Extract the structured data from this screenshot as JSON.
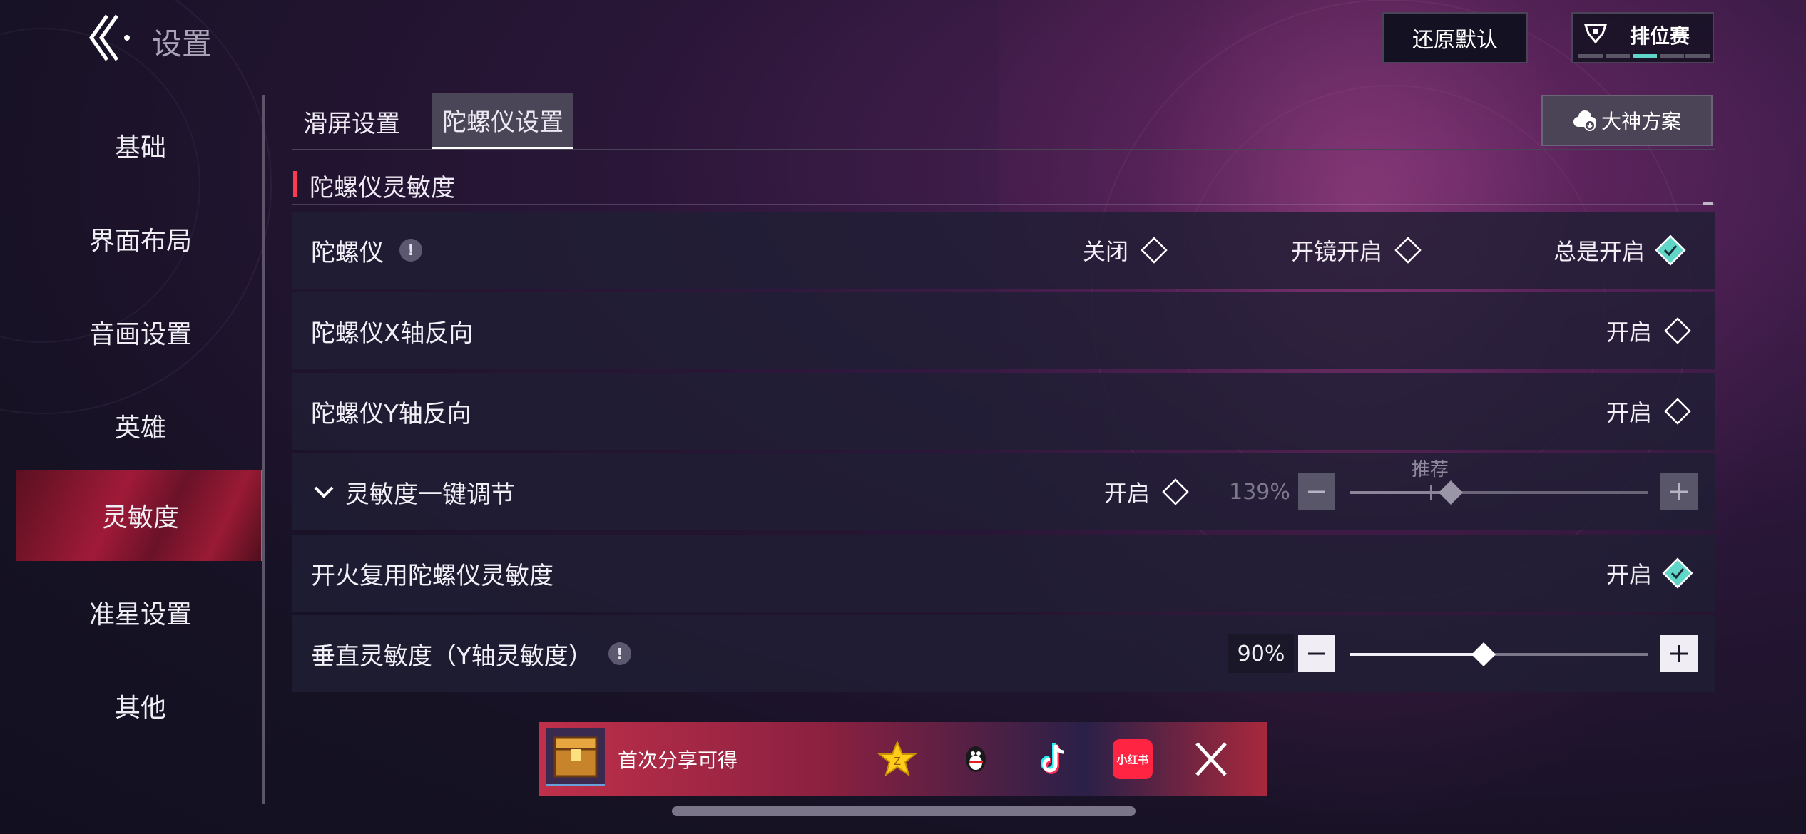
{
  "header": {
    "title": "设置",
    "reset_label": "还原默认",
    "rank_label": "排位赛"
  },
  "sidebar": {
    "items": [
      {
        "label": "基础",
        "active": false
      },
      {
        "label": "界面布局",
        "active": false
      },
      {
        "label": "音画设置",
        "active": false
      },
      {
        "label": "英雄",
        "active": false
      },
      {
        "label": "灵敏度",
        "active": true
      },
      {
        "label": "准星设置",
        "active": false
      },
      {
        "label": "其他",
        "active": false
      }
    ]
  },
  "tabs": [
    {
      "label": "滑屏设置",
      "active": false
    },
    {
      "label": "陀螺仪设置",
      "active": true
    }
  ],
  "pro_button_label": "大神方案",
  "section": {
    "title": "陀螺仪灵敏度"
  },
  "rows": {
    "gyro": {
      "label": "陀螺仪",
      "options": [
        {
          "label": "关闭",
          "selected": false
        },
        {
          "label": "开镜开启",
          "selected": false
        },
        {
          "label": "总是开启",
          "selected": true
        }
      ]
    },
    "x_invert": {
      "label": "陀螺仪X轴反向",
      "option": "开启",
      "selected": false
    },
    "y_invert": {
      "label": "陀螺仪Y轴反向",
      "option": "开启",
      "selected": false
    },
    "quick_adjust": {
      "label": "灵敏度一键调节",
      "option": "开启",
      "selected": false,
      "value_text": "139%",
      "recommend_label": "推荐",
      "level": 0.34,
      "recommend_level": 0.27
    },
    "fire_reuse": {
      "label": "开火复用陀螺仪灵敏度",
      "option": "开启",
      "selected": true
    },
    "vertical": {
      "label": "垂直灵敏度（Y轴灵敏度）",
      "value_text": "90%",
      "level": 0.45
    }
  },
  "share": {
    "label": "首次分享可得",
    "icons": [
      "qzone-icon",
      "qq-icon",
      "tiktok-icon",
      "xiaohongshu-icon",
      "x-icon"
    ],
    "xhs_text": "小红书"
  },
  "colors": {
    "accent_red": "#ff3a52",
    "selected_teal": "#5fd6c8"
  }
}
